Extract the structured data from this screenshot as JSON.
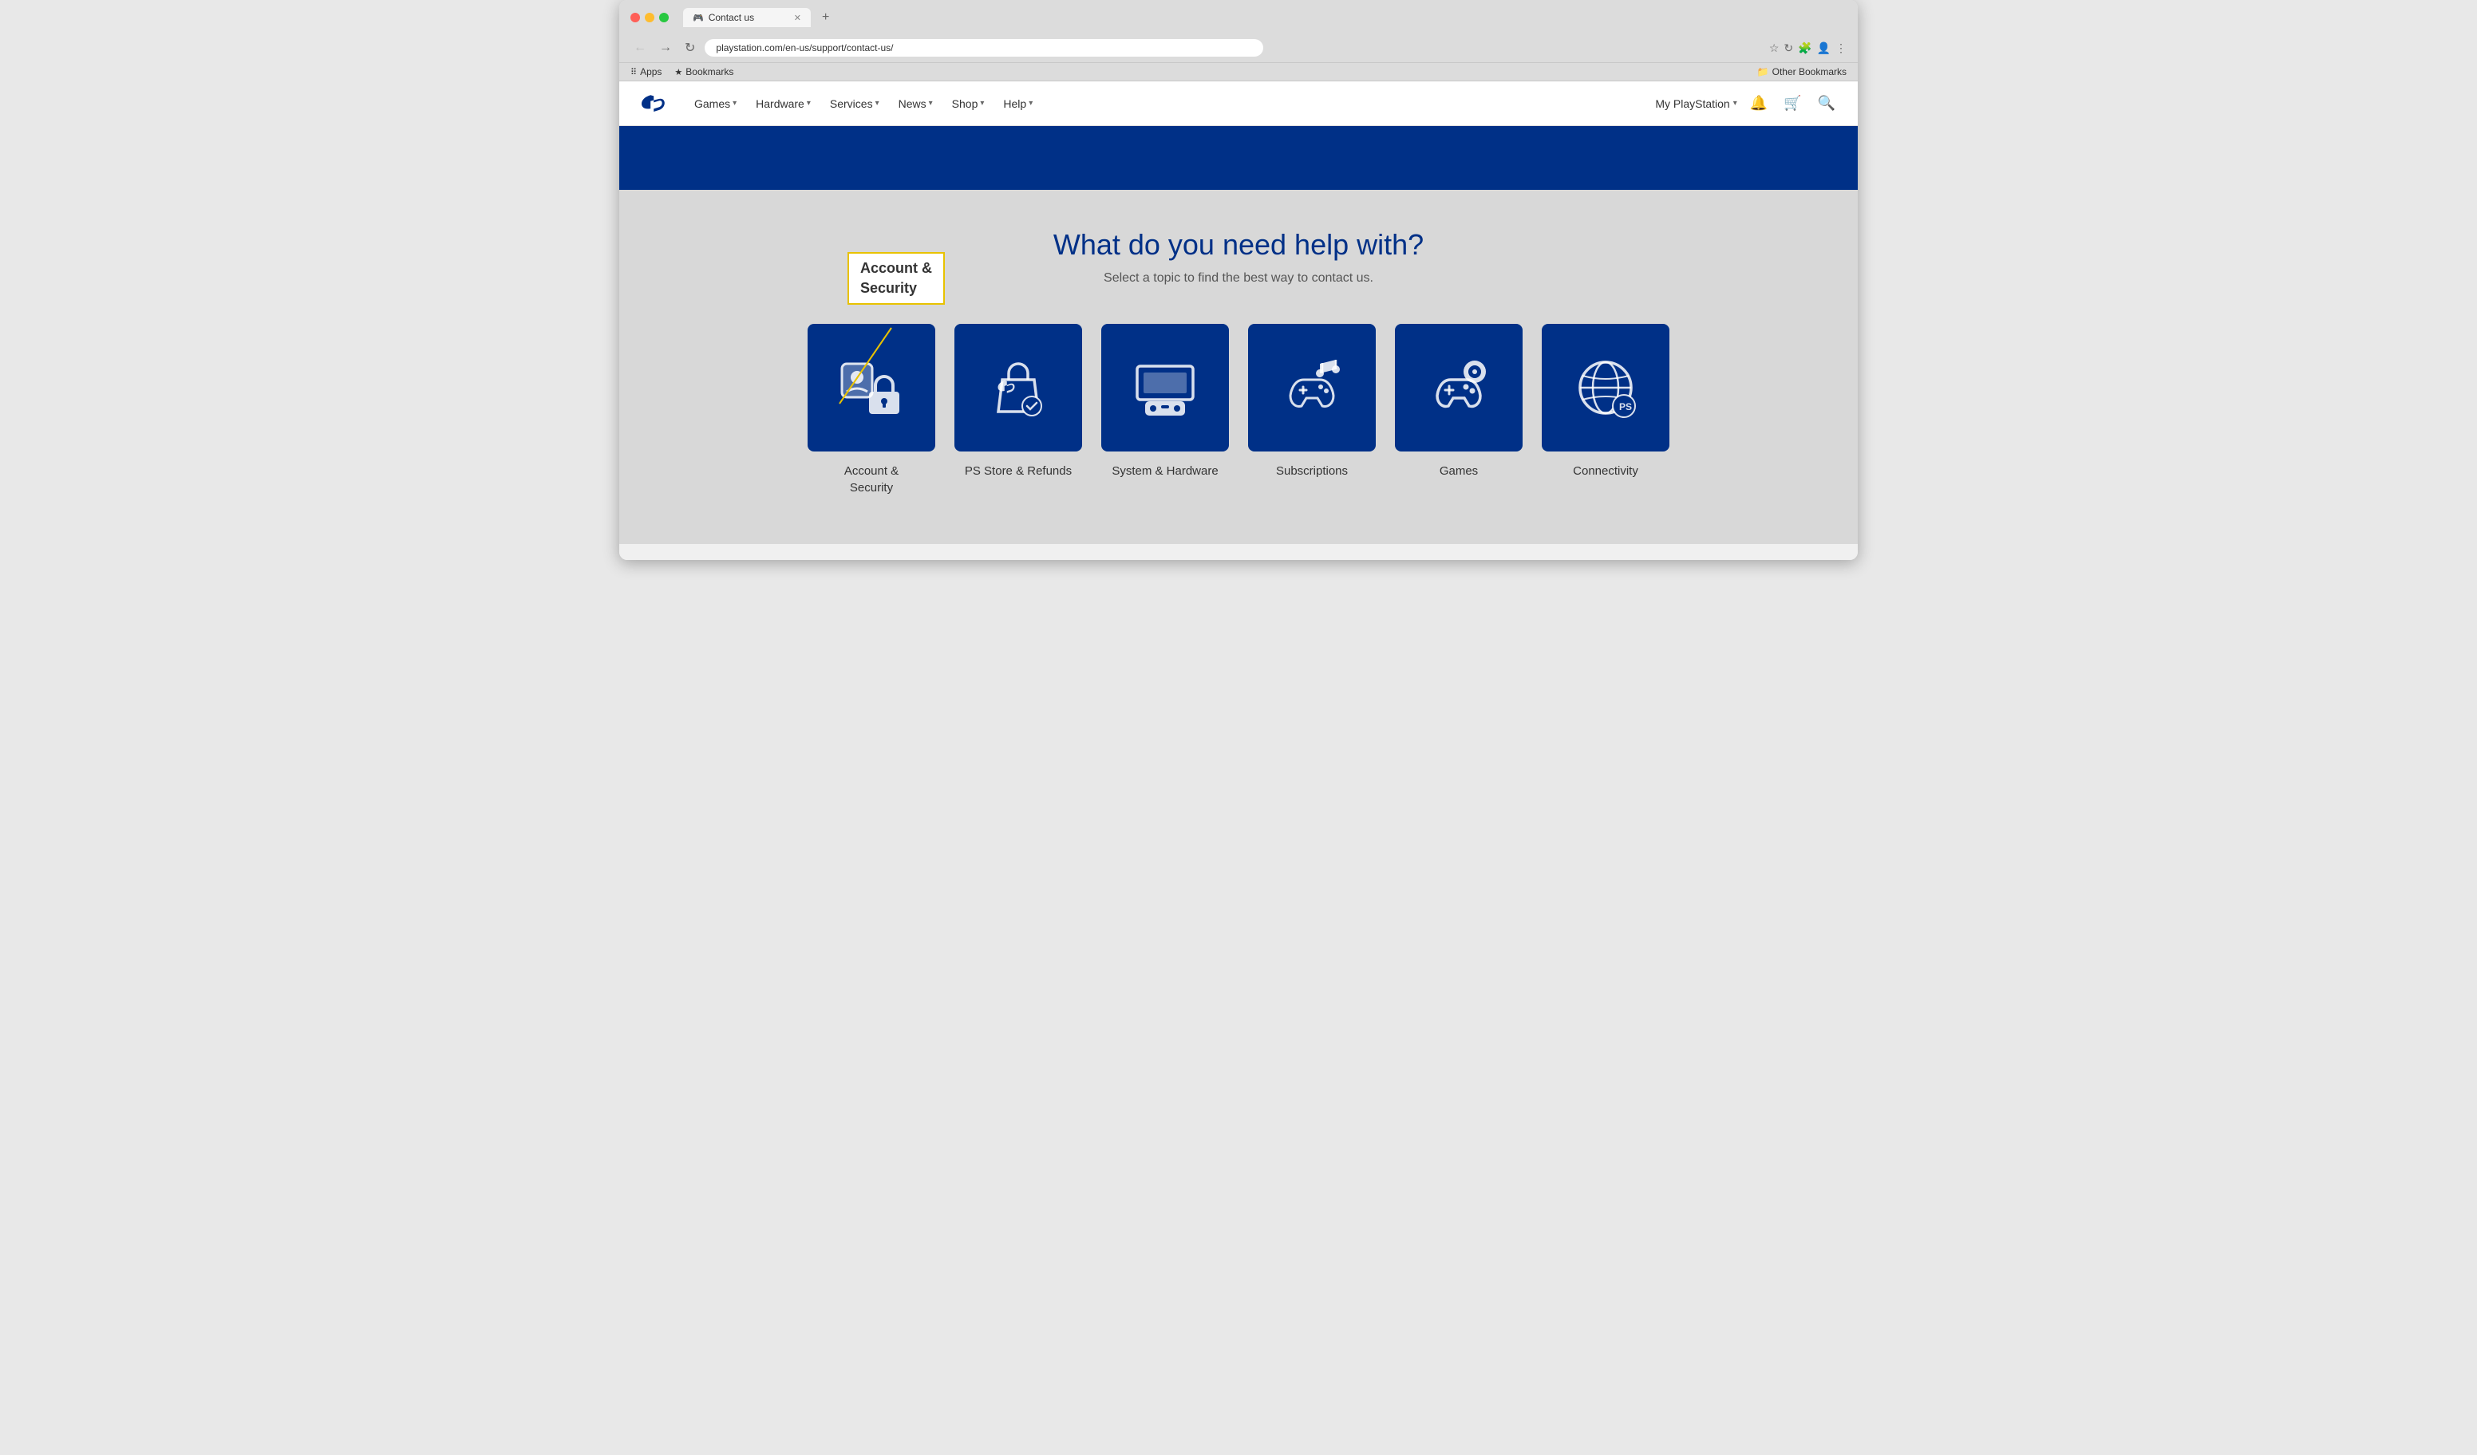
{
  "browser": {
    "tab_title": "Contact us",
    "tab_favicon": "🎮",
    "url": "playstation.com/en-us/support/contact-us/",
    "bookmarks": {
      "apps_label": "Apps",
      "bookmarks_label": "Bookmarks",
      "other_bookmarks_label": "Other Bookmarks"
    }
  },
  "nav": {
    "items": [
      {
        "label": "Games",
        "has_chevron": true
      },
      {
        "label": "Hardware",
        "has_chevron": true
      },
      {
        "label": "Services",
        "has_chevron": true
      },
      {
        "label": "News",
        "has_chevron": true
      },
      {
        "label": "Shop",
        "has_chevron": true
      },
      {
        "label": "Help",
        "has_chevron": true
      }
    ],
    "my_playstation": "My PlayStation"
  },
  "page": {
    "title": "What do you need help with?",
    "subtitle": "Select a topic to find the best way to contact us.",
    "topics": [
      {
        "id": "account",
        "label": "Account &\nSecurity"
      },
      {
        "id": "ps-store",
        "label": "PS Store & Refunds"
      },
      {
        "id": "system",
        "label": "System & Hardware"
      },
      {
        "id": "subscriptions",
        "label": "Subscriptions"
      },
      {
        "id": "games",
        "label": "Games"
      },
      {
        "id": "connectivity",
        "label": "Connectivity"
      }
    ]
  },
  "annotation": {
    "text_line1": "Account &",
    "text_line2": "Security"
  }
}
